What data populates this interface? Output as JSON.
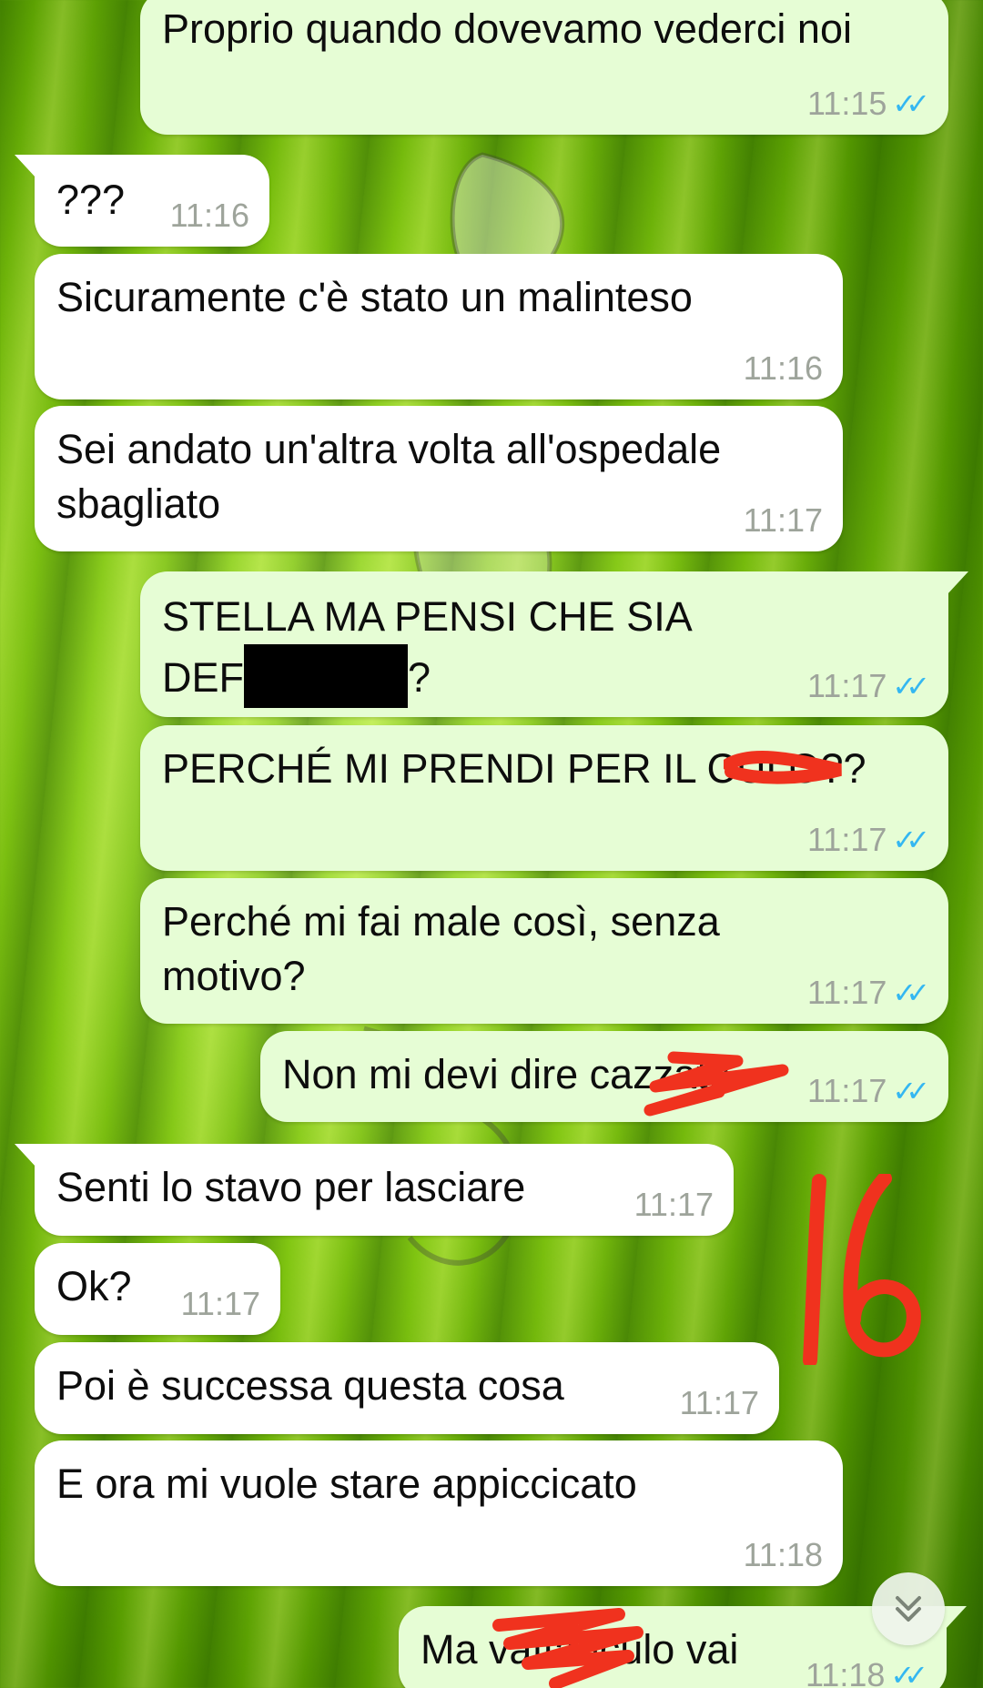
{
  "messages": [
    {
      "direction": "outgoing",
      "text": "Proprio quando dovevamo vederci noi",
      "time": "11:15",
      "status_icon": "double-check-read"
    },
    {
      "direction": "incoming",
      "text": "???",
      "time": "11:16"
    },
    {
      "direction": "incoming",
      "text": "Sicuramente c'è stato un malinteso",
      "time": "11:16"
    },
    {
      "direction": "incoming",
      "text": "Sei andato un'altra volta all'ospedale\nsbagliato",
      "time": "11:17"
    },
    {
      "direction": "outgoing",
      "text_line1": "STELLA MA PENSI CHE SIA",
      "text_line2_prefix": "DEF",
      "text_line2_suffix": "?",
      "time": "11:17",
      "status_icon": "double-check-read"
    },
    {
      "direction": "outgoing",
      "text": "PERCHÉ MI PRENDI PER IL CULO??",
      "time": "11:17",
      "status_icon": "double-check-read"
    },
    {
      "direction": "outgoing",
      "text": "Perché mi fai male così, senza\nmotivo?",
      "time": "11:17",
      "status_icon": "double-check-read"
    },
    {
      "direction": "outgoing",
      "text": "Non mi devi dire cazzate",
      "time": "11:17",
      "status_icon": "double-check-read"
    },
    {
      "direction": "incoming",
      "text": "Senti lo stavo per lasciare",
      "time": "11:17"
    },
    {
      "direction": "incoming",
      "text": "Ok?",
      "time": "11:17"
    },
    {
      "direction": "incoming",
      "text": "Poi è successa questa cosa",
      "time": "11:17"
    },
    {
      "direction": "incoming",
      "text": "E ora mi vuole stare appiccicato",
      "time": "11:18"
    },
    {
      "direction": "outgoing",
      "text": "Ma vaffanculo vai",
      "time": "11:18",
      "status_icon": "double-check-read"
    }
  ],
  "read_ticks": "✓✓",
  "annotation_text": "16",
  "colors": {
    "outgoing_bubble": "#e6fdd5",
    "incoming_bubble": "#ffffff",
    "read_tick": "#34b7f1",
    "timestamp": "#9ea49b",
    "scribble_red": "#f0321e",
    "wallpaper_green": "#7cc20e"
  },
  "scroll_button_icon": "chevron-double-down-icon"
}
